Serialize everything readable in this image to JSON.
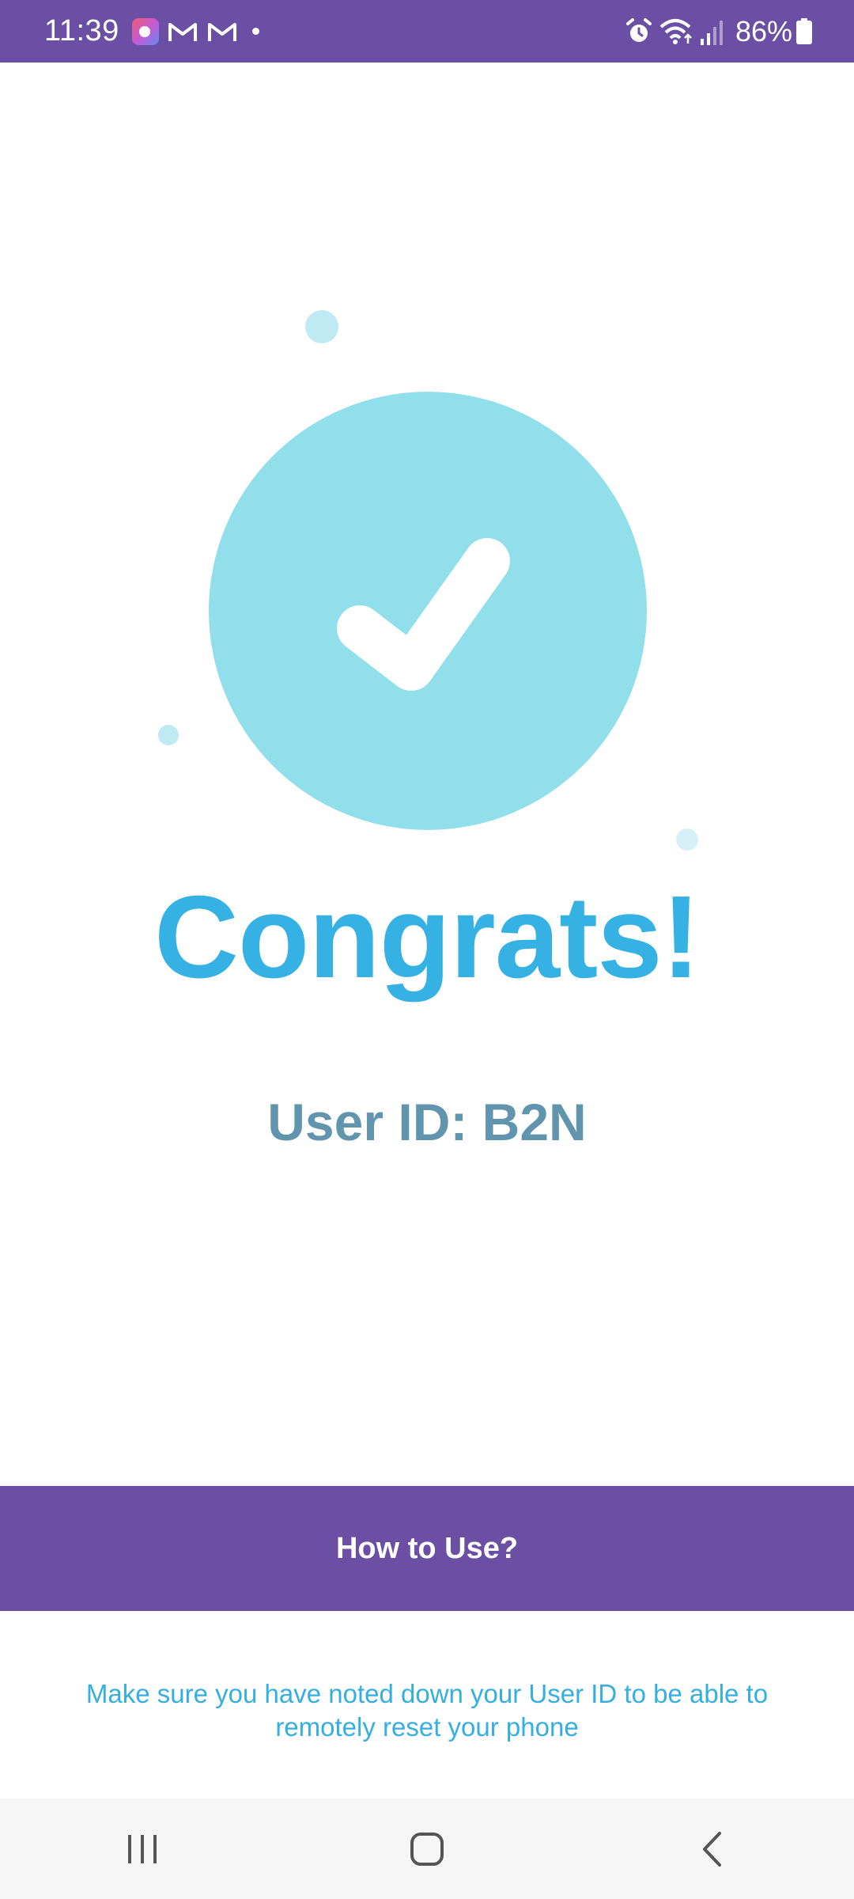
{
  "status_bar": {
    "time": "11:39",
    "battery": "86%",
    "icons": [
      "app-notification-icon",
      "gmail-icon",
      "gmail-icon",
      "dot-icon",
      "alarm-icon",
      "wifi-icon",
      "signal-icon",
      "battery-icon"
    ]
  },
  "main": {
    "headline": "Congrats!",
    "user_id": "User ID: B2N",
    "icon": "checkmark-icon"
  },
  "how_to_button": {
    "label": "How to Use?"
  },
  "note": {
    "text": "Make sure you have noted down your User ID to be able to remotely reset your phone"
  },
  "nav_bar": {
    "icons": [
      "recent-apps-icon",
      "home-icon",
      "back-icon"
    ]
  },
  "colors": {
    "brand_purple": "#6a4fa4",
    "accent_blue": "#35b1e4",
    "user_id_color": "#6195ad",
    "circle_fill": "#92dfec"
  }
}
